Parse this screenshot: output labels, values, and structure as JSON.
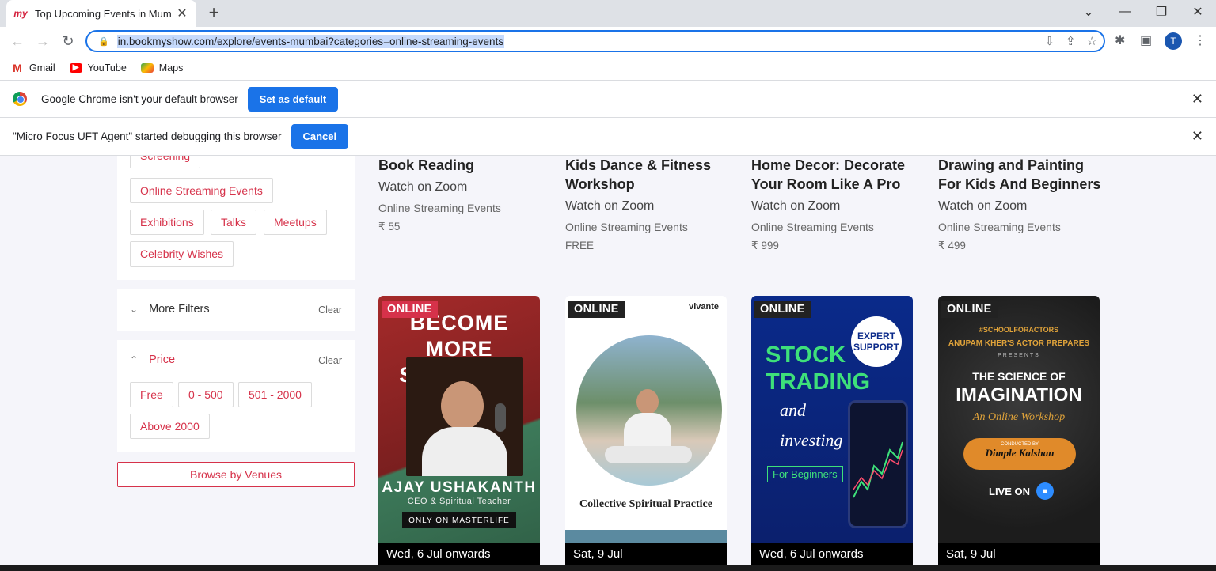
{
  "browser": {
    "tab_title": "Top Upcoming Events in Mumbai",
    "tab_favicon": "my",
    "url": "in.bookmyshow.com/explore/events-mumbai?categories=online-streaming-events",
    "profile_initial": "T",
    "bookmarks": [
      {
        "label": "Gmail",
        "icon": "gmail-icon"
      },
      {
        "label": "YouTube",
        "icon": "youtube-icon"
      },
      {
        "label": "Maps",
        "icon": "maps-icon"
      }
    ],
    "infobar_default": {
      "text": "Google Chrome isn't your default browser",
      "button": "Set as default"
    },
    "infobar_debug": {
      "text": "\"Micro Focus UFT Agent\" started debugging this browser",
      "button": "Cancel"
    }
  },
  "filters": {
    "category_chips": [
      "Screening",
      "Online Streaming Events",
      "Exhibitions",
      "Talks",
      "Meetups",
      "Celebrity Wishes"
    ],
    "more_filters": {
      "label": "More Filters",
      "clear": "Clear"
    },
    "price": {
      "label": "Price",
      "clear": "Clear",
      "chips": [
        "Free",
        "0 - 500",
        "501 - 2000",
        "Above 2000"
      ]
    },
    "browse_venues": "Browse by Venues"
  },
  "events_top": [
    {
      "title": "Book Reading",
      "sub": "Watch on Zoom",
      "category": "Online Streaming Events",
      "price": "₹ 55"
    },
    {
      "title": "Kids Dance & Fitness Workshop",
      "sub": "Watch on Zoom",
      "category": "Online Streaming Events",
      "price": "FREE"
    },
    {
      "title": "Home Decor: Decorate Your Room Like A Pro",
      "sub": "Watch on Zoom",
      "category": "Online Streaming Events",
      "price": "₹ 999"
    },
    {
      "title": "Drawing and Painting For Kids And Beginners",
      "sub": "Watch on Zoom",
      "category": "Online Streaming Events",
      "price": "₹ 499"
    }
  ],
  "posters": [
    {
      "tag": "ONLINE",
      "date": "Wed, 6 Jul onwards",
      "line1": "BECOME MORE",
      "line2": "SPIRITUAL",
      "name": "AJAY USHAKANTH",
      "role": "CEO & Spiritual Teacher",
      "badge": "ONLY ON MASTERLIFE"
    },
    {
      "tag": "ONLINE",
      "date": "Sat, 9 Jul",
      "brand": "vivante",
      "caption": "Collective Spiritual Practice"
    },
    {
      "tag": "ONLINE",
      "date": "Wed, 6 Jul onwards",
      "line1": "STOCK",
      "line2": "TRADING",
      "and": "and",
      "investing": "investing",
      "beginners": "For Beginners",
      "support": "EXPERT SUPPORT"
    },
    {
      "tag": "ONLINE",
      "date": "Sat, 9 Jul",
      "hashtag": "#SCHOOLFORACTORS",
      "school": "ANUPAM KHER'S ACTOR PREPARES",
      "presents": "PRESENTS",
      "title1": "THE SCIENCE OF",
      "title2": "IMAGINATION",
      "subtitle": "An Online Workshop",
      "conducted": "CONDUCTED BY",
      "host": "Dimple Kalshan",
      "live": "LIVE ON"
    }
  ]
}
